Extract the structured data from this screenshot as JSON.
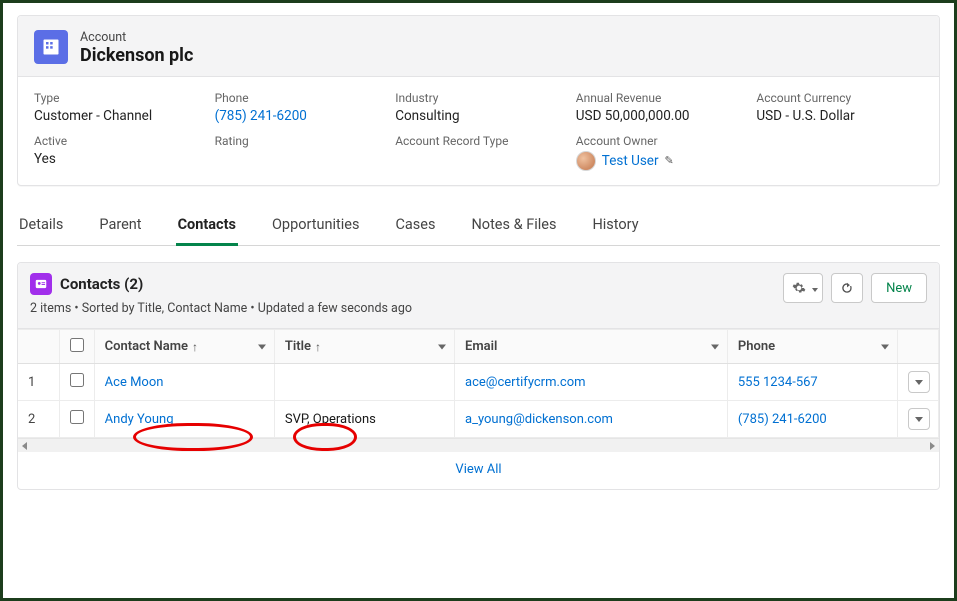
{
  "header": {
    "object_label": "Account",
    "record_name": "Dickenson plc"
  },
  "highlights": {
    "row1": [
      {
        "label": "Type",
        "value": "Customer - Channel"
      },
      {
        "label": "Phone",
        "value": "(785) 241-6200",
        "is_link": true
      },
      {
        "label": "Industry",
        "value": "Consulting"
      },
      {
        "label": "Annual Revenue",
        "value": "USD 50,000,000.00"
      },
      {
        "label": "Account Currency",
        "value": "USD - U.S. Dollar"
      }
    ],
    "row2": [
      {
        "label": "Active",
        "value": "Yes"
      },
      {
        "label": "Rating",
        "value": ""
      },
      {
        "label": "Account Record Type",
        "value": ""
      },
      {
        "label": "Account Owner",
        "owner": "Test User"
      }
    ]
  },
  "tabs": [
    "Details",
    "Parent",
    "Contacts",
    "Opportunities",
    "Cases",
    "Notes & Files",
    "History"
  ],
  "active_tab_index": 2,
  "contacts_list": {
    "title": "Contacts (2)",
    "subtitle": "2 items • Sorted by Title, Contact Name • Updated a few seconds ago",
    "new_button": "New",
    "columns": {
      "name": "Contact Name",
      "title": "Title",
      "email": "Email",
      "phone": "Phone"
    },
    "sort_arrow_glyph": "↑",
    "rows": [
      {
        "num": "1",
        "name": "Ace Moon",
        "title": "",
        "email": "ace@certifycrm.com",
        "phone": "555 1234-567"
      },
      {
        "num": "2",
        "name": "Andy Young",
        "title": "SVP, Operations",
        "email": "a_young@dickenson.com",
        "phone": "(785) 241-6200"
      }
    ],
    "view_all": "View All"
  }
}
